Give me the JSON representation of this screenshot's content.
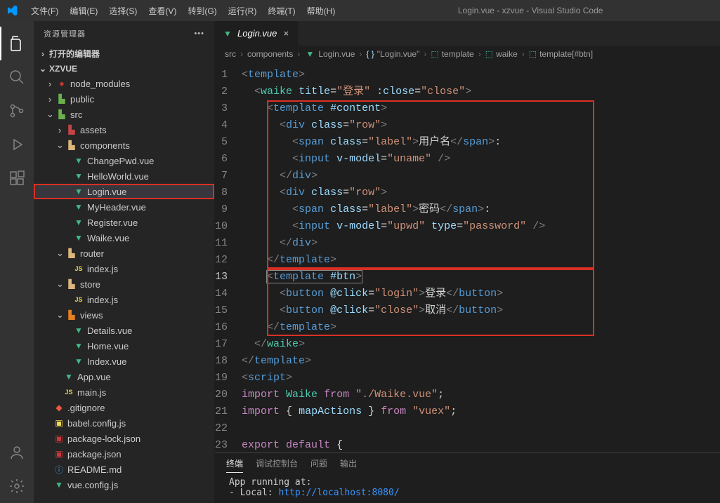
{
  "window_title": "Login.vue - xzvue - Visual Studio Code",
  "menu": {
    "file": "文件(F)",
    "edit": "编辑(E)",
    "select": "选择(S)",
    "view": "查看(V)",
    "goto": "转到(G)",
    "run": "运行(R)",
    "terminal": "终端(T)",
    "help": "帮助(H)"
  },
  "sidebar": {
    "title": "资源管理器",
    "open_editors": "打开的编辑器",
    "project": "XZVUE",
    "tree": {
      "node_modules": "node_modules",
      "public": "public",
      "src": "src",
      "assets": "assets",
      "components": "components",
      "changepwd": "ChangePwd.vue",
      "helloworld": "HelloWorld.vue",
      "login": "Login.vue",
      "myheader": "MyHeader.vue",
      "register": "Register.vue",
      "waike": "Waike.vue",
      "router": "router",
      "router_index": "index.js",
      "store": "store",
      "store_index": "index.js",
      "views": "views",
      "details": "Details.vue",
      "home": "Home.vue",
      "index_vue": "Index.vue",
      "app_vue": "App.vue",
      "main_js": "main.js",
      "gitignore": ".gitignore",
      "babel": "babel.config.js",
      "pkg_lock": "package-lock.json",
      "pkg": "package.json",
      "readme": "README.md",
      "vueconfig": "vue.config.js"
    }
  },
  "tab": {
    "label": "Login.vue"
  },
  "breadcrumbs": {
    "b1": "src",
    "b2": "components",
    "b3": "Login.vue",
    "b4": "\"Login.vue\"",
    "b5": "template",
    "b6": "waike",
    "b7": "template[#btn]"
  },
  "code": {
    "lines": [
      1,
      2,
      3,
      4,
      5,
      6,
      7,
      8,
      9,
      10,
      11,
      12,
      13,
      14,
      15,
      16,
      17,
      18,
      19,
      20,
      21,
      22,
      23
    ],
    "l1_tag": "template",
    "l2_tag": "waike",
    "l2_attr1": "title",
    "l2_val1": "\"登录\"",
    "l2_attr2": ":close",
    "l2_val2": "\"close\"",
    "l3_tag": "template",
    "l3_slot": "#content",
    "l4_tag": "div",
    "l4_attr": "class",
    "l4_val": "\"row\"",
    "l5_tag": "span",
    "l5_attr": "class",
    "l5_val": "\"label\"",
    "l5_text": "用户名",
    "l6_tag": "input",
    "l6_attr": "v-model",
    "l6_val": "\"uname\"",
    "l7_close": "div",
    "l8_tag": "div",
    "l8_attr": "class",
    "l8_val": "\"row\"",
    "l9_tag": "span",
    "l9_attr": "class",
    "l9_val": "\"label\"",
    "l9_text": "密码",
    "l10_tag": "input",
    "l10_attr1": "v-model",
    "l10_val1": "\"upwd\"",
    "l10_attr2": "type",
    "l10_val2": "\"password\"",
    "l11_close": "div",
    "l12_close": "template",
    "l13_tag": "template",
    "l13_slot": "#btn",
    "l14_tag": "button",
    "l14_attr": "@click",
    "l14_val": "\"login\"",
    "l14_text": "登录",
    "l15_tag": "button",
    "l15_attr": "@click",
    "l15_val": "\"close\"",
    "l15_text": "取消",
    "l16_close": "template",
    "l17_close": "waike",
    "l18_close": "template",
    "l19_tag": "script",
    "l20_kw": "import",
    "l20_name": "Waike",
    "l20_from": "from",
    "l20_path": "\"./Waike.vue\"",
    "l21_kw": "import",
    "l21_brace_l": "{",
    "l21_name": "mapActions",
    "l21_brace_r": "}",
    "l21_from": "from",
    "l21_path": "\"vuex\"",
    "l23_kw": "export",
    "l23_kw2": "default",
    "l23_brace": "{"
  },
  "terminal": {
    "tabs": {
      "terminal": "终端",
      "debug": "调试控制台",
      "problems": "问题",
      "output": "输出"
    },
    "line1": "App running at:",
    "line2_prefix": "- Local:   ",
    "line2_url": "http://localhost:8080/"
  }
}
